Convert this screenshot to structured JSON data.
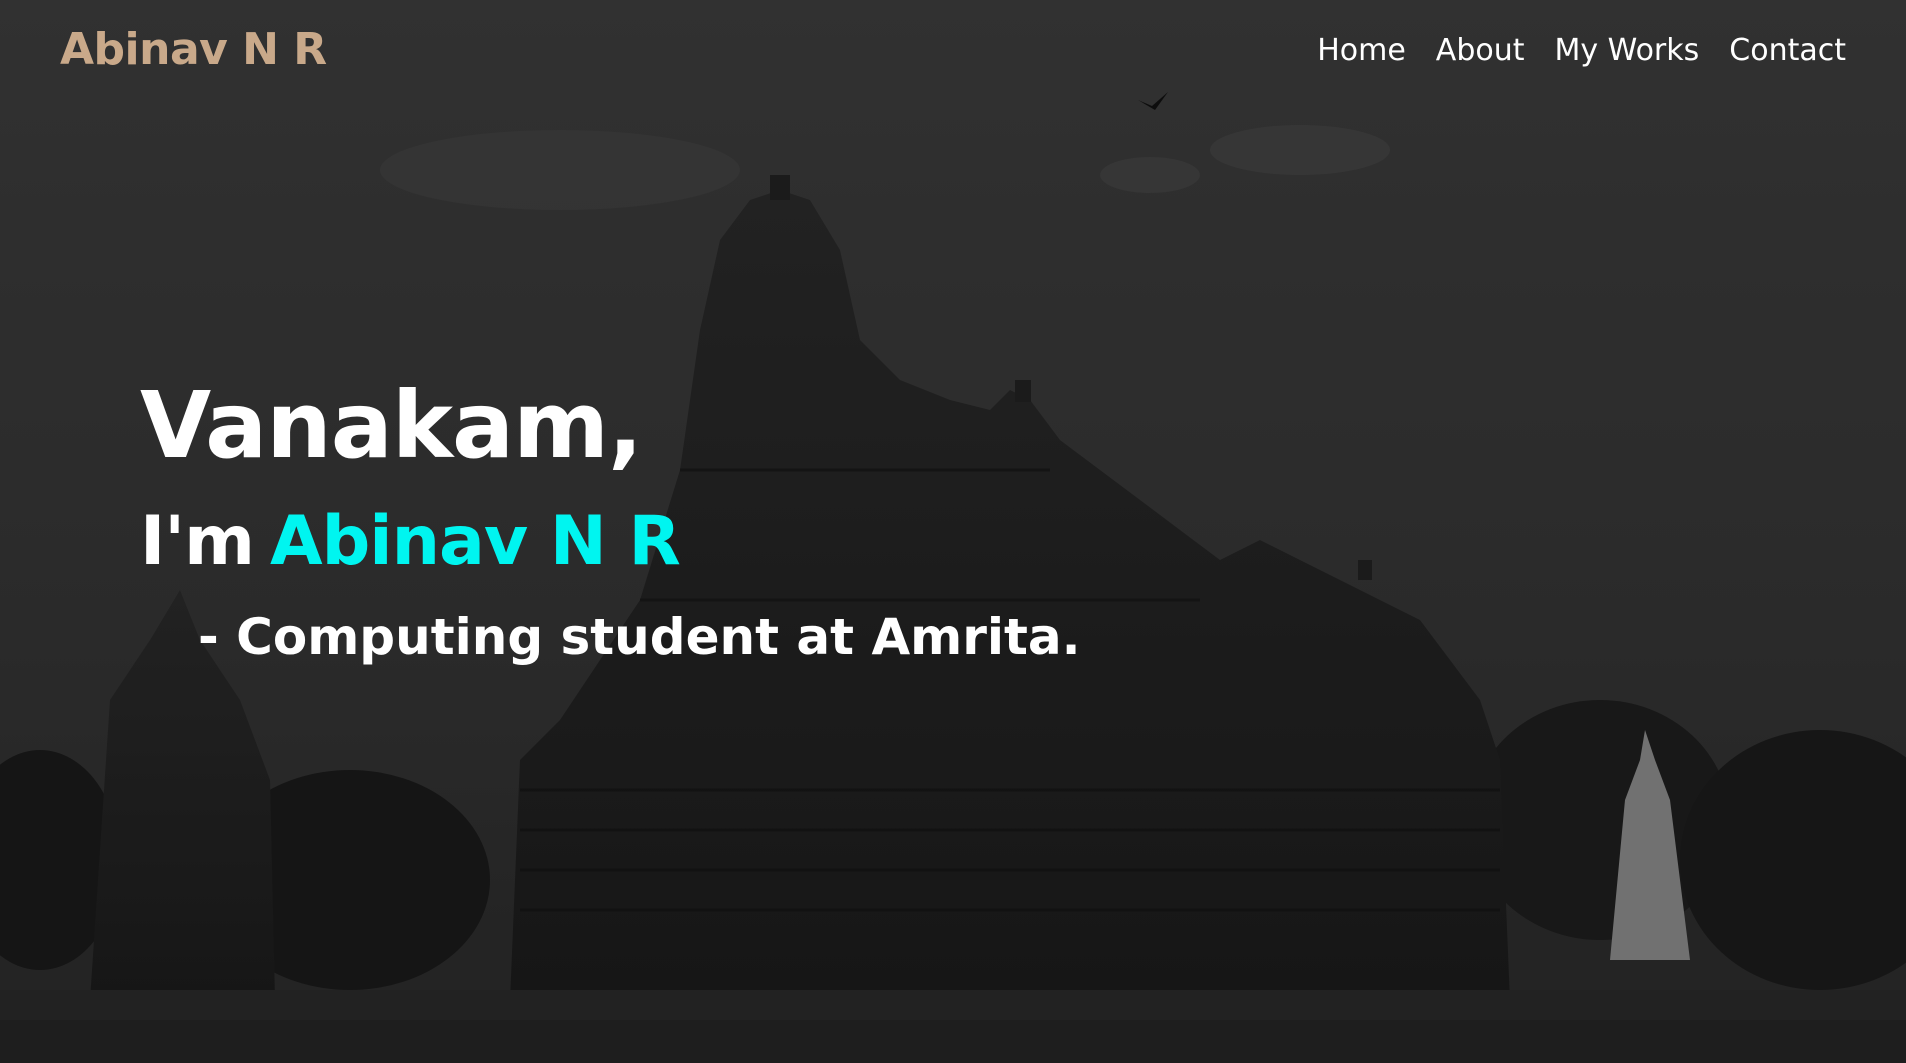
{
  "header": {
    "logo_text": "Abinav N R",
    "nav": [
      {
        "label": "Home"
      },
      {
        "label": "About"
      },
      {
        "label": "My Works"
      },
      {
        "label": "Contact"
      }
    ]
  },
  "hero": {
    "greeting": "Vanakam,",
    "intro_prefix": "I'm",
    "name": "Abinav N R",
    "role": "- Computing student at Amrita.",
    "background_image": "grayscale temple photograph"
  },
  "colors": {
    "logo": "#c9a98a",
    "name_accent": "#00f5f0",
    "text": "#ffffff"
  }
}
